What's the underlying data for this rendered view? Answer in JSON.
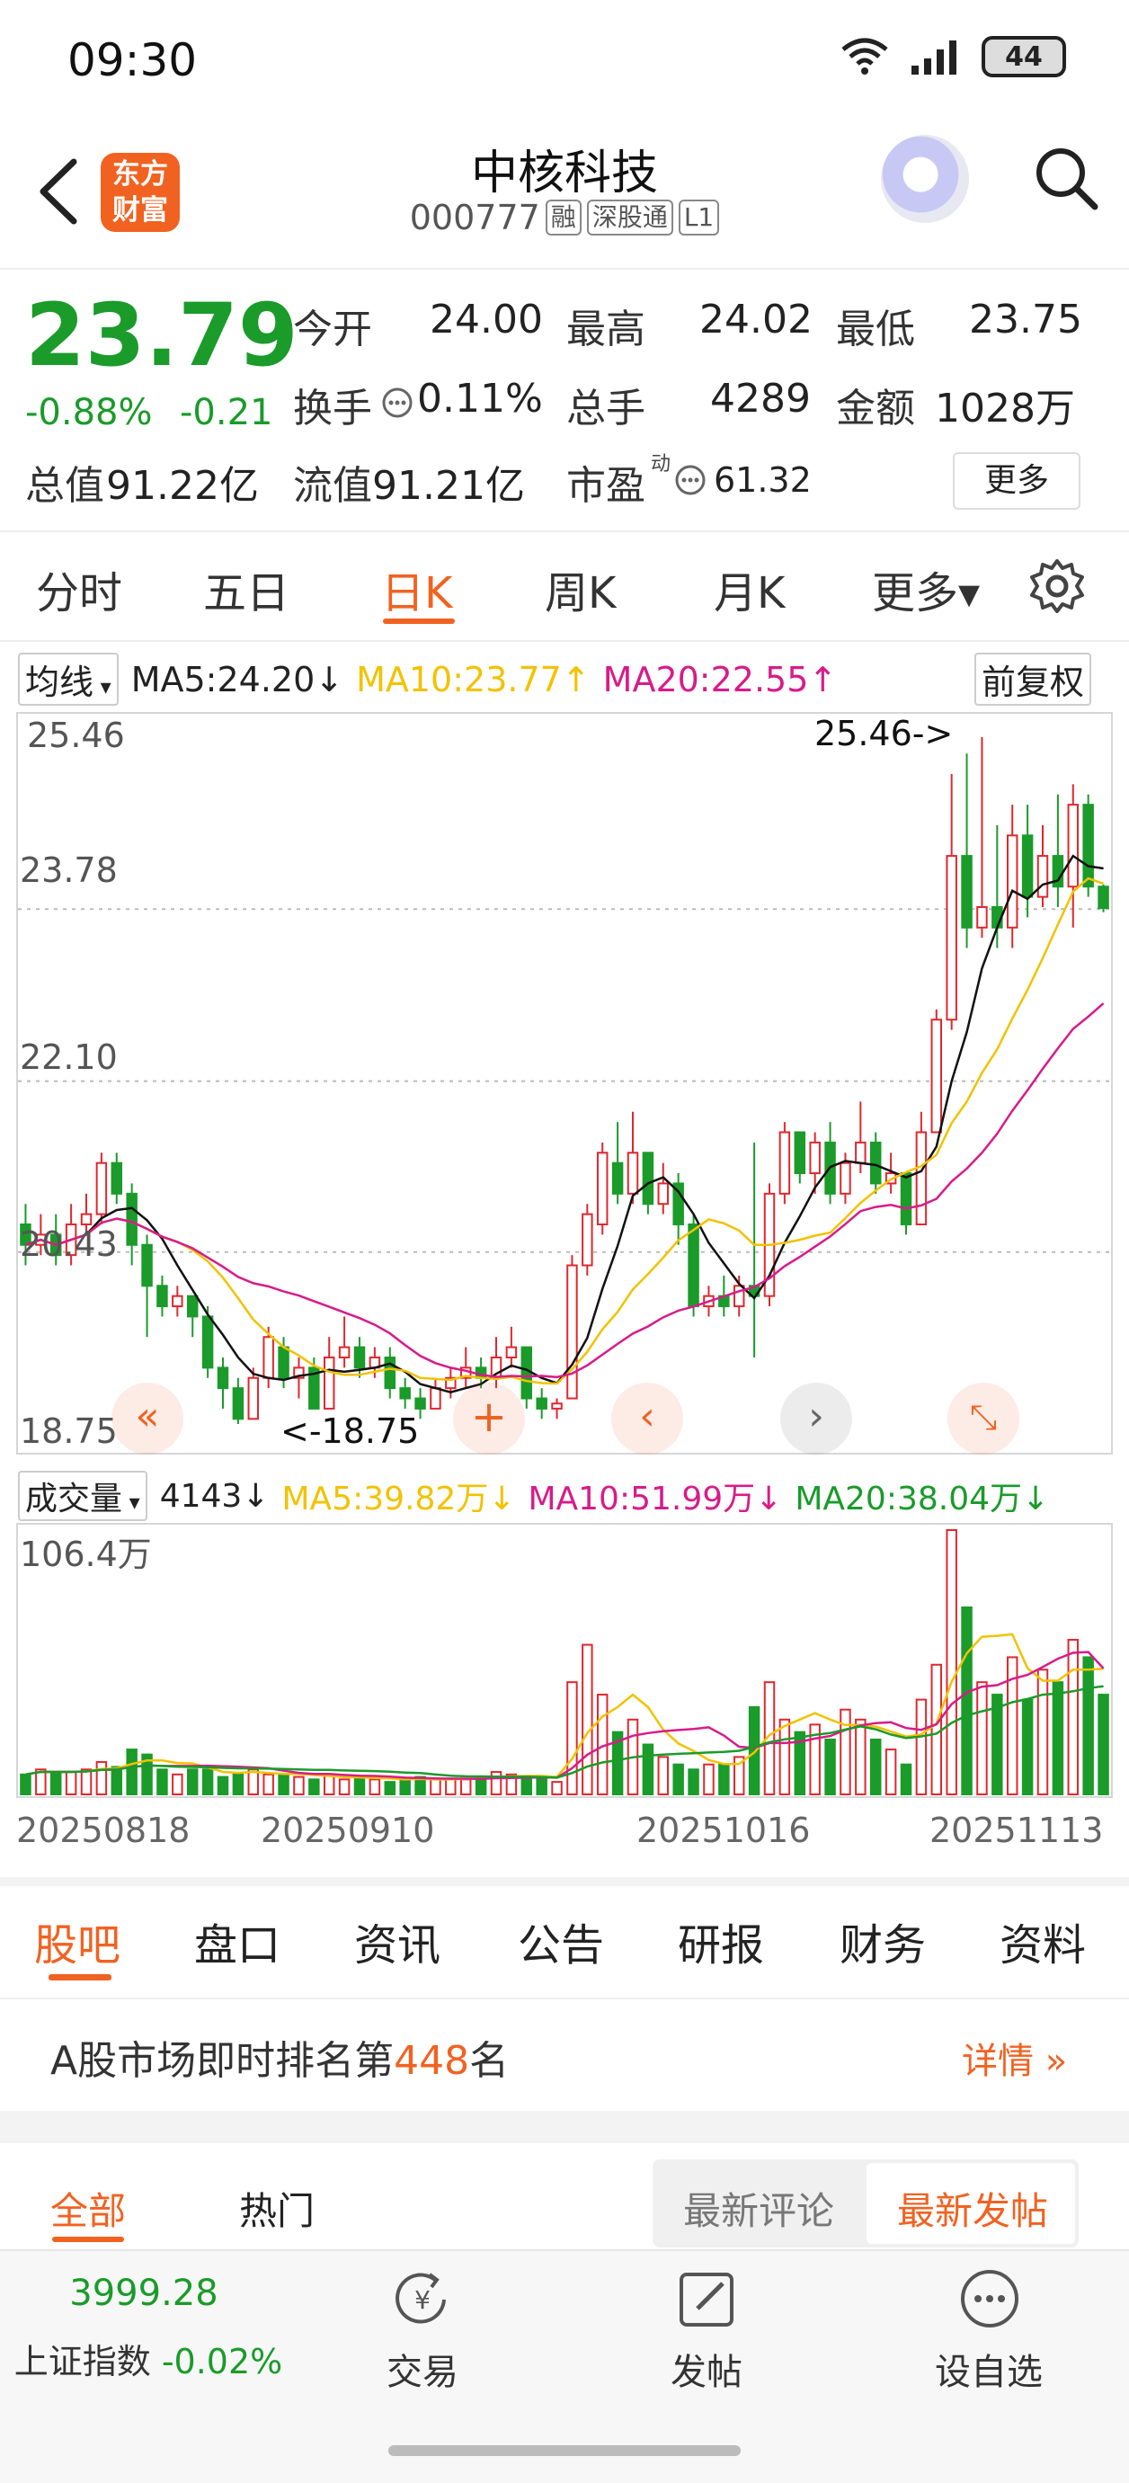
{
  "status_bar": {
    "time": "09:30",
    "battery": "44",
    "wifi_icon": "wifi-icon",
    "signal_icon": "signal-icon"
  },
  "header": {
    "name": "中核科技",
    "code": "000777",
    "tags": [
      "融",
      "深股通",
      "L1"
    ],
    "logo_text_1": "东方",
    "logo_text_2": "财富"
  },
  "quote": {
    "price": "23.79",
    "change_pct": "-0.88%",
    "change": "-0.21",
    "open_label": "今开",
    "open": "24.00",
    "high_label": "最高",
    "high": "24.02",
    "low_label": "最低",
    "low": "23.75",
    "turnover_label": "换手",
    "turnover": "0.11%",
    "volume_label": "总手",
    "volume": "4289",
    "amount_label": "金额",
    "amount": "1028万",
    "mktcap_label": "总值",
    "mktcap": "91.22亿",
    "float_label": "流值",
    "float_cap": "91.21亿",
    "pe_label": "市盈",
    "pe_sup": "动",
    "pe": "61.32",
    "more": "更多"
  },
  "chart_tabs": [
    "分时",
    "五日",
    "日K",
    "周K",
    "月K",
    "更多▾"
  ],
  "ma": {
    "selector": "均线",
    "ma5": "MA5:24.20",
    "ma10": "MA10:23.77",
    "ma20": "MA20:22.55",
    "adjust": "前复权"
  },
  "y_labels": [
    "25.46",
    "23.78",
    "22.10",
    "20.43",
    "18.75"
  ],
  "annotations": {
    "high": "25.46->",
    "low": "<-18.75"
  },
  "volume": {
    "selector": "成交量",
    "last": "4143",
    "ma5": "MA5:39.82万",
    "ma10": "MA10:51.99万",
    "ma20": "MA20:38.04万",
    "max_label": "106.4万"
  },
  "dates": [
    "20250818",
    "20250910",
    "20251016",
    "20251113"
  ],
  "colors": {
    "up": "#e0272e",
    "down": "#1a9b2a",
    "ma5": "#f2c200",
    "ma10": "#d81b8a",
    "ma20": "#1a9b2a",
    "accent": "#f16221"
  },
  "news_tabs": [
    "股吧",
    "盘口",
    "资讯",
    "公告",
    "研报",
    "财务",
    "资料"
  ],
  "rank": {
    "prefix": "A股市场即时排名第",
    "rank": "448",
    "suffix": "名",
    "detail": "详情"
  },
  "post_tabs": {
    "all": "全部",
    "hot": "热门",
    "latest_comment": "最新评论",
    "latest_post": "最新发帖"
  },
  "bottom_nav": {
    "index_value": "3999.28",
    "index_name": "上证指数",
    "index_change": "-0.02%",
    "trade": "交易",
    "post": "发帖",
    "watch": "设自选"
  },
  "chart_data": {
    "type": "candlestick",
    "ylim": [
      18.75,
      25.46
    ],
    "y_ticks": [
      25.46,
      23.78,
      22.1,
      20.43,
      18.75
    ],
    "x_tick_labels": [
      "20250818",
      "20250910",
      "20251016",
      "20251113"
    ],
    "candles": [
      [
        20.7,
        20.5,
        20.9,
        20.3
      ],
      [
        20.5,
        20.6,
        20.8,
        20.4
      ],
      [
        20.6,
        20.4,
        20.8,
        20.3
      ],
      [
        20.4,
        20.7,
        20.9,
        20.3
      ],
      [
        20.7,
        20.8,
        21.0,
        20.6
      ],
      [
        20.8,
        21.3,
        21.4,
        20.7
      ],
      [
        21.3,
        21.0,
        21.4,
        20.9
      ],
      [
        21.0,
        20.5,
        21.1,
        20.3
      ],
      [
        20.5,
        20.1,
        20.6,
        19.6
      ],
      [
        20.1,
        19.9,
        20.2,
        19.8
      ],
      [
        19.9,
        20.0,
        20.1,
        19.8
      ],
      [
        20.0,
        19.8,
        20.0,
        19.6
      ],
      [
        19.8,
        19.3,
        19.9,
        19.2
      ],
      [
        19.3,
        19.1,
        19.4,
        18.9
      ],
      [
        19.1,
        18.8,
        19.2,
        18.75
      ],
      [
        18.8,
        19.2,
        19.3,
        18.8
      ],
      [
        19.2,
        19.6,
        19.7,
        19.1
      ],
      [
        19.5,
        19.2,
        19.6,
        19.1
      ],
      [
        19.2,
        19.3,
        19.4,
        19.0
      ],
      [
        19.3,
        18.9,
        19.4,
        18.9
      ],
      [
        18.9,
        19.4,
        19.6,
        18.9
      ],
      [
        19.4,
        19.5,
        19.8,
        19.3
      ],
      [
        19.5,
        19.3,
        19.6,
        19.2
      ],
      [
        19.3,
        19.4,
        19.5,
        19.2
      ],
      [
        19.4,
        19.1,
        19.5,
        19.0
      ],
      [
        19.1,
        19.0,
        19.2,
        18.9
      ],
      [
        19.0,
        18.9,
        19.1,
        18.8
      ],
      [
        18.9,
        19.1,
        19.2,
        18.9
      ],
      [
        19.1,
        19.2,
        19.3,
        19.0
      ],
      [
        19.2,
        19.3,
        19.5,
        19.1
      ],
      [
        19.3,
        19.2,
        19.4,
        19.1
      ],
      [
        19.2,
        19.4,
        19.6,
        19.1
      ],
      [
        19.4,
        19.5,
        19.7,
        19.3
      ],
      [
        19.5,
        19.0,
        19.5,
        18.9
      ],
      [
        19.0,
        18.9,
        19.1,
        18.8
      ],
      [
        18.9,
        18.95,
        19.0,
        18.8
      ],
      [
        19.0,
        20.3,
        20.4,
        19.0
      ],
      [
        20.3,
        20.8,
        20.9,
        20.2
      ],
      [
        20.7,
        21.4,
        21.5,
        20.6
      ],
      [
        21.3,
        21.0,
        21.7,
        20.9
      ],
      [
        21.0,
        21.4,
        21.8,
        20.9
      ],
      [
        21.4,
        20.9,
        21.4,
        20.8
      ],
      [
        20.9,
        21.1,
        21.3,
        20.8
      ],
      [
        21.1,
        20.7,
        21.2,
        20.5
      ],
      [
        20.7,
        19.9,
        20.8,
        19.8
      ],
      [
        19.9,
        20.0,
        20.1,
        19.8
      ],
      [
        20.0,
        19.9,
        20.2,
        19.8
      ],
      [
        19.9,
        20.1,
        20.2,
        19.8
      ],
      [
        20.1,
        20.0,
        21.5,
        19.4
      ],
      [
        20.0,
        21.0,
        21.1,
        19.9
      ],
      [
        21.0,
        21.6,
        21.7,
        20.9
      ],
      [
        21.6,
        21.2,
        21.6,
        21.1
      ],
      [
        21.2,
        21.5,
        21.6,
        21.0
      ],
      [
        21.5,
        21.0,
        21.7,
        20.9
      ],
      [
        21.0,
        21.3,
        21.4,
        20.9
      ],
      [
        21.3,
        21.5,
        21.9,
        21.2
      ],
      [
        21.5,
        21.1,
        21.6,
        21.0
      ],
      [
        21.1,
        21.2,
        21.4,
        21.0
      ],
      [
        21.2,
        20.7,
        21.2,
        20.6
      ],
      [
        20.7,
        21.6,
        21.8,
        20.7
      ],
      [
        21.6,
        22.7,
        22.8,
        21.6
      ],
      [
        22.7,
        24.3,
        25.1,
        22.6
      ],
      [
        24.3,
        23.6,
        25.3,
        23.4
      ],
      [
        23.6,
        23.8,
        25.46,
        23.5
      ],
      [
        23.8,
        23.6,
        24.6,
        23.4
      ],
      [
        23.6,
        24.5,
        24.8,
        23.4
      ],
      [
        24.5,
        23.9,
        24.8,
        23.7
      ],
      [
        23.9,
        24.3,
        24.6,
        23.8
      ],
      [
        24.3,
        24.0,
        24.9,
        23.8
      ],
      [
        24.0,
        24.8,
        25.0,
        23.6
      ],
      [
        24.8,
        24.0,
        24.9,
        23.9
      ],
      [
        24.0,
        23.79,
        24.02,
        23.75
      ]
    ],
    "volume_max": "106.4万",
    "volumes": [
      8,
      10,
      9,
      9,
      10,
      13,
      11,
      18,
      16,
      10,
      8,
      10,
      10,
      7,
      8,
      10,
      8,
      8,
      7,
      6,
      8,
      6,
      7,
      6,
      5,
      6,
      7,
      6,
      6,
      6,
      7,
      9,
      8,
      7,
      6,
      5,
      45,
      60,
      40,
      25,
      30,
      20,
      15,
      12,
      10,
      12,
      12,
      15,
      35,
      45,
      30,
      25,
      28,
      22,
      34,
      30,
      22,
      18,
      12,
      38,
      52,
      106,
      75,
      45,
      40,
      55,
      38,
      50,
      45,
      62,
      55,
      40
    ]
  }
}
